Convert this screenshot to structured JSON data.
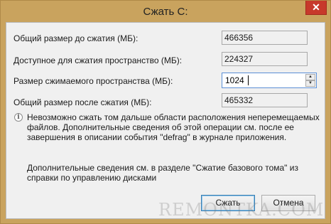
{
  "window": {
    "title": "Сжать C:",
    "close_glyph": "✕"
  },
  "fields": {
    "total_size_label": "Общий размер до сжатия (МБ):",
    "total_size_value": "466356",
    "available_label": "Доступное для сжатия пространство (МБ):",
    "available_value": "224327",
    "shrink_label": "Размер сжимаемого пространства (МБ):",
    "shrink_value": "1024",
    "after_label": "Общий размер после сжатия (МБ):",
    "after_value": "465332"
  },
  "info": {
    "icon": "info-icon",
    "text_line1": "Невозможно сжать том дальше области расположения неперемещаемых",
    "text_line2": "файлов. Дополнительные сведения об этой операции см. после ее",
    "text_line3": "завершения в описании события \"defrag\" в журнале приложения.",
    "help_line1": "Дополнительные сведения см. в разделе \"Сжатие базового тома\" из",
    "help_line2": "справки по управлению дисками"
  },
  "buttons": {
    "shrink_label": "Сжать",
    "cancel_label": "Отмена"
  },
  "watermark": "REMONTKA.COM",
  "colors": {
    "frame": "#c9a35e",
    "close": "#c7392b",
    "focus": "#5b8fd6"
  }
}
